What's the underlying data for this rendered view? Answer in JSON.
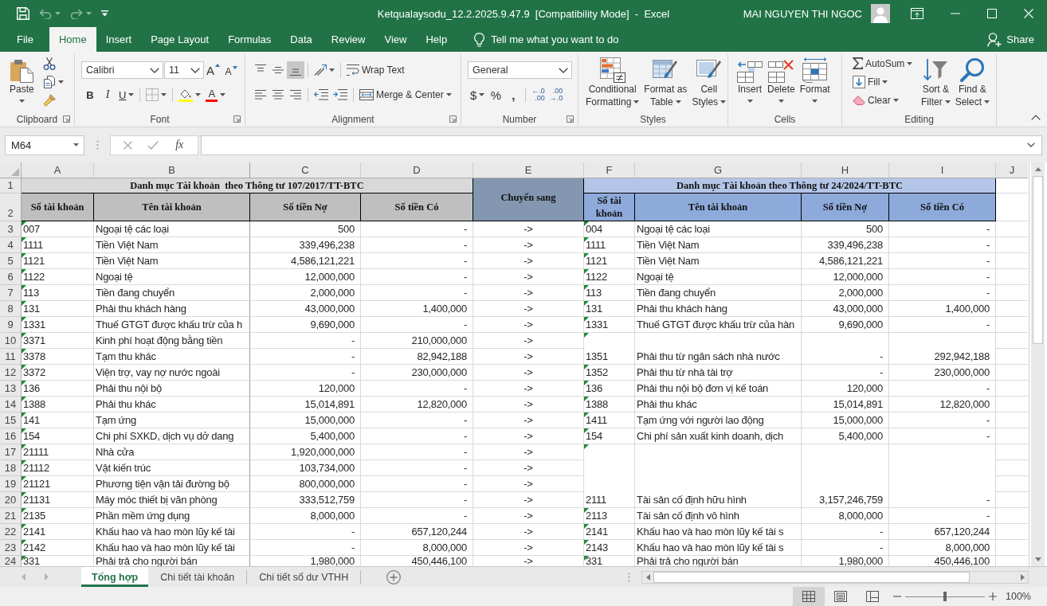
{
  "window": {
    "title": "Ketqualaysodu_12.2.2025.9.47.9  [Compatibility Mode]  -  Excel",
    "user": "MAI NGUYEN THI NGOC"
  },
  "quick_access": [
    {
      "kind": "save",
      "disabled": false
    },
    {
      "kind": "undo",
      "disabled": true
    },
    {
      "kind": "redo",
      "disabled": true
    },
    {
      "kind": "customize",
      "disabled": false
    }
  ],
  "ribbon_tabs": [
    {
      "label": "File",
      "selected": false
    },
    {
      "label": "Home",
      "selected": true
    },
    {
      "label": "Insert",
      "selected": false
    },
    {
      "label": "Page Layout",
      "selected": false
    },
    {
      "label": "Formulas",
      "selected": false
    },
    {
      "label": "Data",
      "selected": false
    },
    {
      "label": "Review",
      "selected": false
    },
    {
      "label": "View",
      "selected": false
    },
    {
      "label": "Help",
      "selected": false
    }
  ],
  "tell_me": {
    "placeholder": "Tell me what you want to do"
  },
  "share": "Share",
  "ribbon": {
    "clipboard": {
      "label": "Clipboard",
      "paste": "Paste"
    },
    "font": {
      "label": "Font",
      "name": "Calibri",
      "size": "11",
      "grow": "A",
      "shrink": "A",
      "bold": "B",
      "italic": "I",
      "underline": "U",
      "tint_letter": "A"
    },
    "alignment": {
      "label": "Alignment",
      "vertical": [
        {
          "kind": "top",
          "selected": false
        },
        {
          "kind": "middle",
          "selected": false
        },
        {
          "kind": "bottom",
          "selected": true
        }
      ],
      "horizontal": [
        {
          "kind": "left",
          "selected": false
        },
        {
          "kind": "center",
          "selected": false
        },
        {
          "kind": "right",
          "selected": false
        }
      ],
      "wrap_text": "Wrap Text",
      "merge": "Merge & Center"
    },
    "number": {
      "label": "Number",
      "format": "General",
      "currency": "$",
      "percent": "%",
      "comma": ",",
      "increase_decimal": [
        "←.0",
        ".00"
      ],
      "decrease_decimal": [
        ".00",
        "→.0"
      ]
    },
    "styles": {
      "label": "Styles",
      "buttons": [
        {
          "kind": "conditional",
          "lines": [
            "Conditional",
            "Formatting"
          ]
        },
        {
          "kind": "table",
          "lines": [
            "Format as",
            "Table"
          ]
        },
        {
          "kind": "cell_styles",
          "lines": [
            "Cell",
            "Styles"
          ]
        }
      ]
    },
    "cells": {
      "label": "Cells",
      "buttons": [
        {
          "kind": "insert",
          "label": "Insert"
        },
        {
          "kind": "delete",
          "label": "Delete"
        },
        {
          "kind": "format",
          "label": "Format"
        }
      ]
    },
    "editing": {
      "label": "Editing",
      "small": [
        {
          "kind": "autosum",
          "label": "AutoSum"
        },
        {
          "kind": "fill",
          "label": "Fill"
        },
        {
          "kind": "clear",
          "label": "Clear"
        }
      ],
      "buttons": [
        {
          "kind": "sort",
          "lines": [
            "Sort &",
            "Filter"
          ]
        },
        {
          "kind": "find",
          "lines": [
            "Find &",
            "Select"
          ]
        }
      ]
    }
  },
  "formula_bar": {
    "name_box": "M64",
    "function_label": "fx"
  },
  "sheet": {
    "column_headers": [
      "A",
      "B",
      "C",
      "D",
      "E",
      "F",
      "G",
      "H",
      "I",
      "J"
    ],
    "row_headers": [
      "1",
      "2",
      "3",
      "4",
      "5",
      "6",
      "7",
      "8",
      "9",
      "10",
      "11",
      "12",
      "13",
      "14",
      "15",
      "16",
      "17",
      "18",
      "19",
      "20",
      "21",
      "22",
      "23",
      "24"
    ],
    "left_title": "Danh mục Tài khoản  theo Thông tư 107/2017/TT-BTC",
    "transfer_header": "Chuyển sang",
    "right_title": "Danh mục Tài khoản theo Thông tư 24/2024/TT-BTC",
    "left_headers": [
      "Số tài khoản",
      "Tên tài khoản",
      "Số tiền Nợ",
      "Số tiền Có"
    ],
    "right_headers": [
      "Số tài khoản",
      "Tên tài khoản",
      "Số tiền Nợ",
      "Số tiền Có"
    ],
    "left_rows": [
      {
        "account": "007",
        "name": "Ngoại tệ các loại",
        "debit": "500",
        "credit": "-",
        "transfer": "->",
        "flagged": true
      },
      {
        "account": "1111",
        "name": "Tiền Việt Nam",
        "debit": "339,496,238",
        "credit": "-",
        "transfer": "->",
        "flagged": true
      },
      {
        "account": "1121",
        "name": "Tiền Việt Nam",
        "debit": "4,586,121,221",
        "credit": "-",
        "transfer": "->",
        "flagged": true
      },
      {
        "account": "1122",
        "name": "Ngoại tệ",
        "debit": "12,000,000",
        "credit": "-",
        "transfer": "->",
        "flagged": true
      },
      {
        "account": "113",
        "name": "Tiền đang chuyển",
        "debit": "2,000,000",
        "credit": "-",
        "transfer": "->",
        "flagged": true
      },
      {
        "account": "131",
        "name": "Phải thu khách hàng",
        "debit": "43,000,000",
        "credit": "1,400,000",
        "transfer": "->",
        "flagged": true
      },
      {
        "account": "1331",
        "name": "Thuế GTGT được khấu trừ của h",
        "debit": "9,690,000",
        "credit": "-",
        "transfer": "->",
        "flagged": true
      },
      {
        "account": "3371",
        "name": "Kinh phí hoạt động bằng tiền",
        "debit": "-",
        "credit": "210,000,000",
        "transfer": "->",
        "flagged": true
      },
      {
        "account": "3378",
        "name": "Tạm thu khác",
        "debit": "-",
        "credit": "82,942,188",
        "transfer": "->",
        "flagged": true
      },
      {
        "account": "3372",
        "name": "Viện trợ, vay nợ nước ngoài",
        "debit": "-",
        "credit": "230,000,000",
        "transfer": "->",
        "flagged": true
      },
      {
        "account": "136",
        "name": "Phải thu nội bộ",
        "debit": "120,000",
        "credit": "-",
        "transfer": "->",
        "flagged": true
      },
      {
        "account": "1388",
        "name": "Phải thu khác",
        "debit": "15,014,891",
        "credit": "12,820,000",
        "transfer": "->",
        "flagged": true
      },
      {
        "account": "141",
        "name": "Tạm ứng",
        "debit": "15,000,000",
        "credit": "-",
        "transfer": "->",
        "flagged": true
      },
      {
        "account": "154",
        "name": "Chi phí SXKD, dịch vụ dở dang",
        "debit": "5,400,000",
        "credit": "-",
        "transfer": "->",
        "flagged": true
      },
      {
        "account": "21111",
        "name": "Nhà cửa",
        "debit": "1,920,000,000",
        "credit": "-",
        "transfer": "->",
        "flagged": true
      },
      {
        "account": "21112",
        "name": "Vật kiến trúc",
        "debit": "103,734,000",
        "credit": "-",
        "transfer": "->",
        "flagged": true
      },
      {
        "account": "21121",
        "name": "Phương tiện vận tải đường bộ",
        "debit": "800,000,000",
        "credit": "-",
        "transfer": "->",
        "flagged": true
      },
      {
        "account": "21131",
        "name": "Máy móc thiết bị văn phòng",
        "debit": "333,512,759",
        "credit": "-",
        "transfer": "->",
        "flagged": true
      },
      {
        "account": "2135",
        "name": "Phần mềm ứng dụng",
        "debit": "8,000,000",
        "credit": "-",
        "transfer": "->",
        "flagged": true
      },
      {
        "account": "2141",
        "name": "Khấu hao và hao mòn lũy kế tài",
        "debit": "-",
        "credit": "657,120,244",
        "transfer": "->",
        "flagged": true
      },
      {
        "account": "2142",
        "name": "Khấu hao và hao mòn lũy kế tài",
        "debit": "-",
        "credit": "8,000,000",
        "transfer": "->",
        "flagged": true
      },
      {
        "account": "331",
        "name": "Phải trả cho người bán",
        "debit": "1,980,000",
        "credit": "450,446,100",
        "transfer": "->",
        "flagged": true
      }
    ],
    "right_rows": [
      {
        "kind": "single",
        "account": "004",
        "name": "Ngoại tệ các loại",
        "debit": "500",
        "credit": "-",
        "flagged": true
      },
      {
        "kind": "single",
        "account": "1111",
        "name": "Tiền Việt Nam",
        "debit": "339,496,238",
        "credit": "-",
        "flagged": true
      },
      {
        "kind": "single",
        "account": "1121",
        "name": "Tiền Việt Nam",
        "debit": "4,586,121,221",
        "credit": "-",
        "flagged": true
      },
      {
        "kind": "single",
        "account": "1122",
        "name": "Ngoại tệ",
        "debit": "12,000,000",
        "credit": "-",
        "flagged": true
      },
      {
        "kind": "single",
        "account": "113",
        "name": "Tiền đang chuyển",
        "debit": "2,000,000",
        "credit": "-",
        "flagged": true
      },
      {
        "kind": "single",
        "account": "131",
        "name": "Phải thu khách hàng",
        "debit": "43,000,000",
        "credit": "1,400,000",
        "flagged": true
      },
      {
        "kind": "single",
        "account": "1331",
        "name": "Thuế GTGT được khấu trừ của hàn",
        "debit": "9,690,000",
        "credit": "-",
        "flagged": true
      },
      {
        "kind": "double",
        "account": "1351",
        "name": "Phải thu từ ngân sách nhà nước",
        "debit": "-",
        "credit": "292,942,188",
        "flagged": true
      },
      {
        "kind": "single",
        "account": "1352",
        "name": "Phải thu từ nhà tài trợ",
        "debit": "-",
        "credit": "230,000,000",
        "flagged": true
      },
      {
        "kind": "single",
        "account": "136",
        "name": "Phải thu nội bộ đơn vị kế toán",
        "debit": "120,000",
        "credit": "-",
        "flagged": true
      },
      {
        "kind": "single",
        "account": "1388",
        "name": "Phải thu khác",
        "debit": "15,014,891",
        "credit": "12,820,000",
        "flagged": true
      },
      {
        "kind": "single",
        "account": "1411",
        "name": "Tạm ứng với người lao động",
        "debit": "15,000,000",
        "credit": "-",
        "flagged": true
      },
      {
        "kind": "single",
        "account": "154",
        "name": "Chi phí sản xuất kinh doanh, dịch",
        "debit": "5,400,000",
        "credit": "-",
        "flagged": true
      },
      {
        "kind": "quadruple",
        "account": "2111",
        "name": "Tài sản cố định hữu hình",
        "debit": "3,157,246,759",
        "credit": "-",
        "flagged": true
      },
      {
        "kind": "single",
        "account": "2113",
        "name": "Tài sản cố định vô hình",
        "debit": "8,000,000",
        "credit": "-",
        "flagged": true
      },
      {
        "kind": "single",
        "account": "2141",
        "name": "Khấu hao và hao mòn lũy kế tài s",
        "debit": "-",
        "credit": "657,120,244",
        "flagged": true
      },
      {
        "kind": "single",
        "account": "2143",
        "name": "Khấu hao và hao mòn lũy kế tài s",
        "debit": "-",
        "credit": "8,000,000",
        "flagged": true
      },
      {
        "kind": "single",
        "account": "331",
        "name": "Phải trả cho người bán",
        "debit": "1,980,000",
        "credit": "450,446,100",
        "flagged": true
      }
    ]
  },
  "sheet_tabs": [
    {
      "label": "Tổng hợp",
      "selected": true
    },
    {
      "label": "Chi tiết tài khoản",
      "selected": false
    },
    {
      "label": "Chi tiết số dư VTHH",
      "selected": false
    }
  ],
  "status_bar": {
    "views": [
      {
        "kind": "normal",
        "selected": true
      },
      {
        "kind": "page_layout",
        "selected": false
      },
      {
        "kind": "page_break",
        "selected": false
      }
    ],
    "zoom": {
      "level": 0.5,
      "reading": "100%"
    }
  }
}
